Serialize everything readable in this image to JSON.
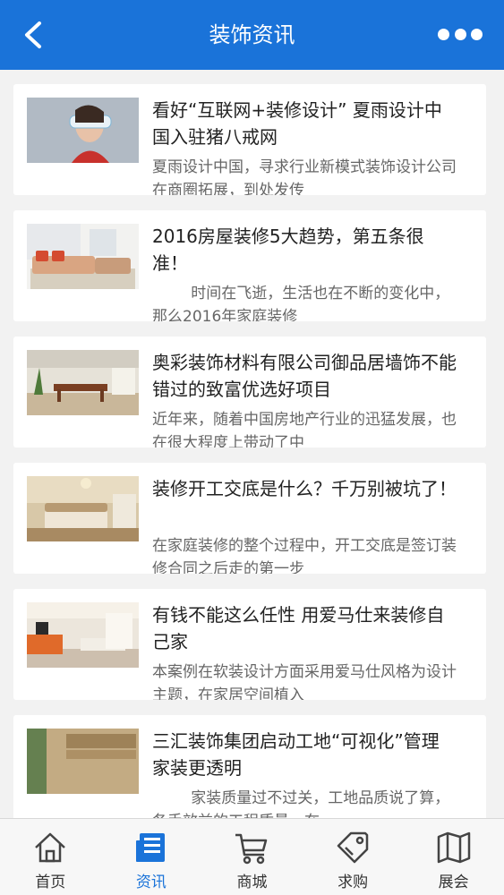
{
  "header": {
    "title": "装饰资讯",
    "back_icon": "chevron-left-icon",
    "more_icon": "more-dots-icon",
    "color": "#1a73d9"
  },
  "articles": [
    {
      "title": "看好“互联网+装修设计” 夏雨设计中国入驻猪八戒网",
      "summary": "夏雨设计中国，寻求行业新模式装饰设计公司在商圈拓展，到处发传"
    },
    {
      "title": "2016房屋装修5大趋势，第五条很准！",
      "summary": "        时间在飞逝，生活也在不断的变化中，那么2016年家庭装修"
    },
    {
      "title": "奥彩装饰材料有限公司御品居墙饰不能错过的致富优选好项目",
      "summary": "近年来，随着中国房地产行业的迅猛发展，也在很大程度上带动了中"
    },
    {
      "title": "装修开工交底是什么？千万别被坑了！",
      "summary": "在家庭装修的整个过程中，开工交底是签订装修合同之后走的第一步"
    },
    {
      "title": "有钱不能这么任性 用爱马仕来装修自己家",
      "summary": "本案例在软装设计方面采用爱马仕风格为设计主题，在家居空间植入"
    },
    {
      "title": "三汇装饰集团启动工地“可视化”管理 家装更透明",
      "summary": "        家装质量过不过关，工地品质说了算，各手效益的工程质量，在"
    }
  ],
  "tabbar": {
    "active_color": "#1a73d9",
    "tabs": [
      {
        "label": "首页",
        "icon": "home-icon"
      },
      {
        "label": "资讯",
        "icon": "news-icon",
        "active": true
      },
      {
        "label": "商城",
        "icon": "cart-icon"
      },
      {
        "label": "求购",
        "icon": "tag-icon"
      },
      {
        "label": "展会",
        "icon": "map-icon"
      }
    ]
  }
}
